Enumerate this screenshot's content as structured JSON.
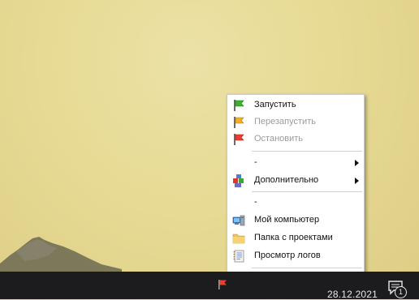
{
  "context_menu": {
    "items": [
      {
        "label": "Запустить",
        "icon": "green-flag-icon",
        "disabled": false
      },
      {
        "label": "Перезапустить",
        "icon": "yellow-flag-icon",
        "disabled": true
      },
      {
        "label": "Остановить",
        "icon": "red-flag-icon",
        "disabled": true
      },
      {
        "label": "-",
        "submenu": true
      },
      {
        "label": "Дополнительно",
        "icon": "blocks-icon",
        "submenu": true
      },
      {
        "label": "-"
      },
      {
        "label": "Мой компьютер",
        "icon": "computer-icon"
      },
      {
        "label": "Папка с проектами",
        "icon": "folder-icon"
      },
      {
        "label": "Просмотр логов",
        "icon": "log-notebook-icon"
      },
      {
        "label": "-"
      }
    ]
  },
  "taskbar": {
    "date": "28.12.2021",
    "notification_count": "1",
    "tray_icon": "red-flag-icon"
  },
  "colors": {
    "menu_bg": "#ffffff",
    "disabled_text": "#9b9b9b",
    "taskbar_bg": "#1c1c1e"
  }
}
